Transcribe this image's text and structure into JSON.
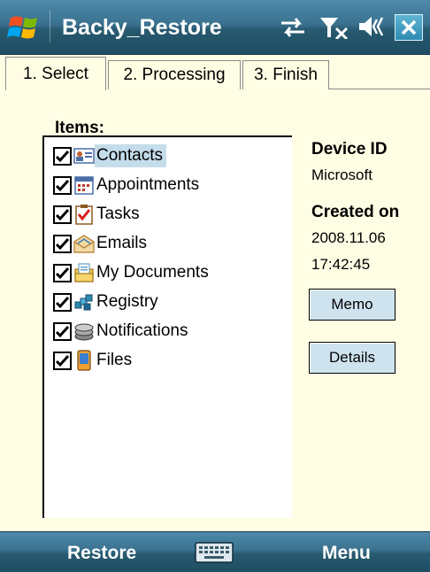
{
  "titlebar": {
    "app_title": "Backy_Restore",
    "close_label": "✕"
  },
  "tabs": [
    {
      "label": "1. Select",
      "active": true
    },
    {
      "label": "2. Processing",
      "active": false
    },
    {
      "label": "3. Finish",
      "active": false
    }
  ],
  "items": {
    "header": "Items:",
    "list": [
      {
        "label": "Contacts",
        "checked": true,
        "selected": true,
        "icon": "contacts-icon"
      },
      {
        "label": "Appointments",
        "checked": true,
        "selected": false,
        "icon": "calendar-icon"
      },
      {
        "label": "Tasks",
        "checked": true,
        "selected": false,
        "icon": "tasks-icon"
      },
      {
        "label": "Emails",
        "checked": true,
        "selected": false,
        "icon": "email-icon"
      },
      {
        "label": "My Documents",
        "checked": true,
        "selected": false,
        "icon": "documents-icon"
      },
      {
        "label": "Registry",
        "checked": true,
        "selected": false,
        "icon": "registry-icon"
      },
      {
        "label": "Notifications",
        "checked": true,
        "selected": false,
        "icon": "notifications-icon"
      },
      {
        "label": "Files",
        "checked": true,
        "selected": false,
        "icon": "files-icon"
      }
    ]
  },
  "info": {
    "device_id_label": "Device ID",
    "device_id_value": "Microsoft",
    "created_on_label": "Created on",
    "created_date": "2008.11.06",
    "created_time": "17:42:45"
  },
  "buttons": {
    "memo_label": "Memo",
    "details_label": "Details"
  },
  "softkeys": {
    "left": "Restore",
    "right": "Menu"
  },
  "colors": {
    "bar_blue": "#27596f",
    "background": "#fffde4",
    "button_face": "#cfe3ef",
    "selection": "#c5dcea"
  }
}
